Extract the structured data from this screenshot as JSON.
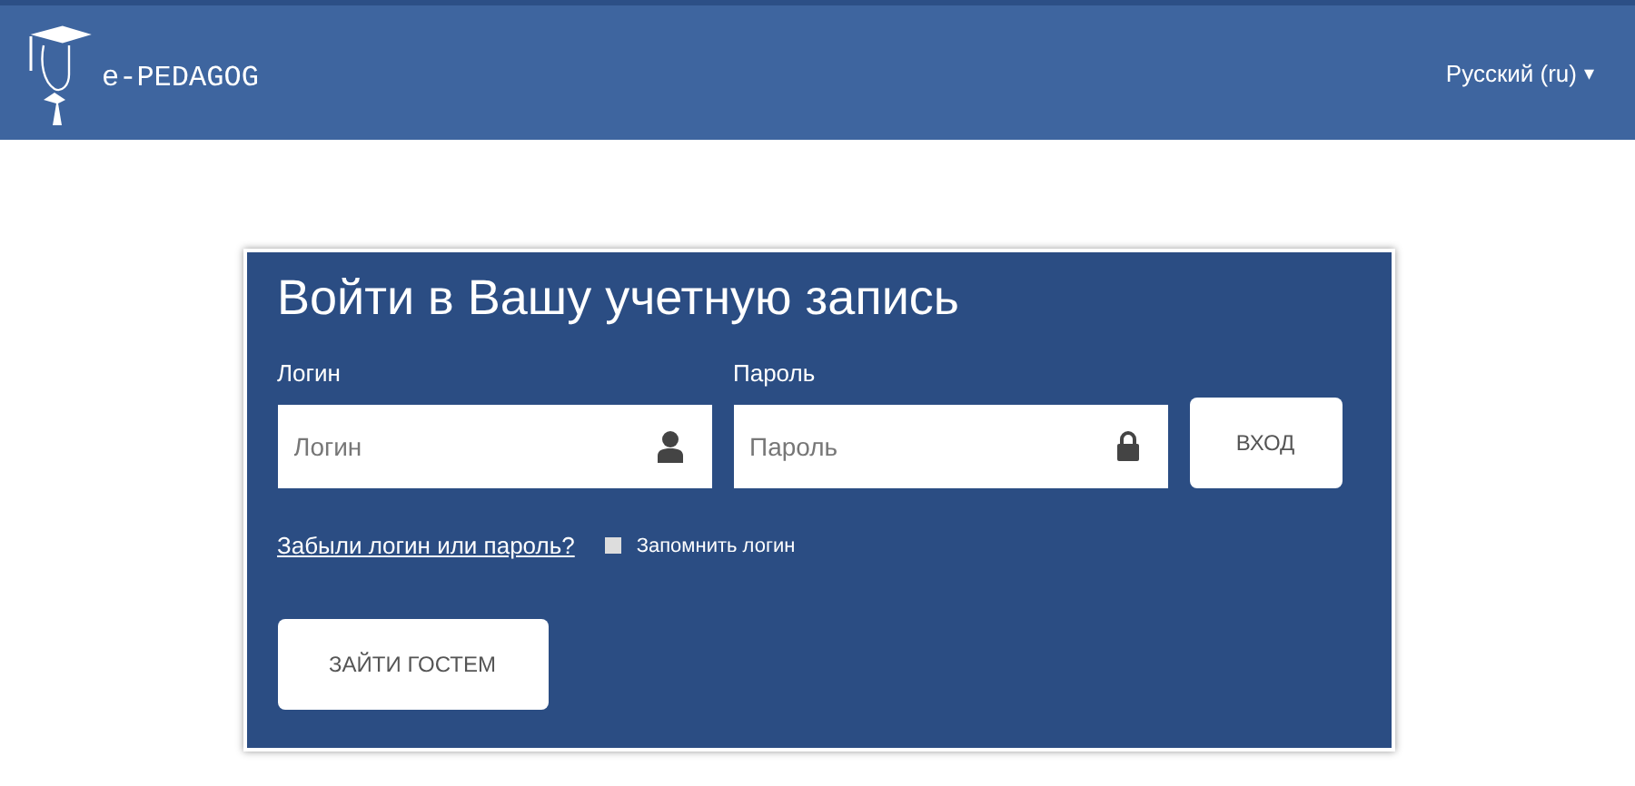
{
  "header": {
    "logo_text": "e-PEDAGOG",
    "language": "Русский (ru)",
    "caret": "▾"
  },
  "login_card": {
    "title": "Войти в Вашу учетную запись",
    "fields": [
      {
        "label": "Логин",
        "placeholder": "Логин",
        "kind": "user"
      },
      {
        "label": "Пароль",
        "placeholder": "Пароль",
        "kind": "password"
      }
    ],
    "submit": "ВХОД",
    "forgot_link": "Забыли логин или пароль?",
    "remember": {
      "label": "Запомнить логин",
      "checked": false
    },
    "guest_button": "ЗАЙТИ ГОСТЕМ"
  }
}
